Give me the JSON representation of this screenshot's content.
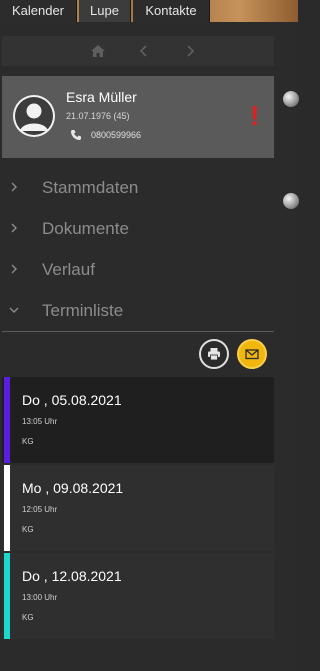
{
  "tabs": [
    {
      "label": "Kalender"
    },
    {
      "label": "Lupe"
    },
    {
      "label": "Kontakte"
    }
  ],
  "navigation": {
    "home_icon": "home-icon",
    "prev_icon": "chevron-left-icon",
    "next_icon": "chevron-right-icon"
  },
  "patient": {
    "name": "Esra Müller",
    "dob": "21.07.1976 (45)",
    "phone": "0800599966",
    "alert": "!",
    "alert_color": "#e0201e"
  },
  "sections": [
    {
      "label": "Stammdaten",
      "expanded": false
    },
    {
      "label": "Dokumente",
      "expanded": false
    },
    {
      "label": "Verlauf",
      "expanded": false
    },
    {
      "label": "Terminliste",
      "expanded": true
    }
  ],
  "actions": {
    "print_icon": "printer-icon",
    "mail_icon": "mail-icon",
    "mail_color": "#f2b70f"
  },
  "appointments": [
    {
      "date": "Do , 05.08.2021",
      "time": "13:05 Uhr",
      "type": "KG",
      "color": "#5a1ee0"
    },
    {
      "date": "Mo , 09.08.2021",
      "time": "12:05 Uhr",
      "type": "KG",
      "color": "#ffffff"
    },
    {
      "date": "Do , 12.08.2021",
      "time": "13:00 Uhr",
      "type": "KG",
      "color": "#1ed6d0"
    }
  ]
}
